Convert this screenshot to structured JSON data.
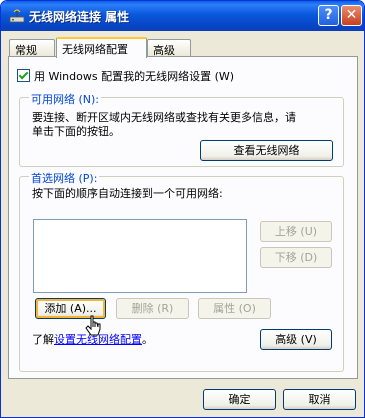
{
  "window": {
    "title": "无线网络连接 属性",
    "help_button": "?",
    "close_button": "✕"
  },
  "tabs": [
    {
      "label": "常规",
      "active": false
    },
    {
      "label": "无线网络配置",
      "active": true
    },
    {
      "label": "高级",
      "active": false
    }
  ],
  "use_windows_checkbox": {
    "label": "用 Windows 配置我的无线网络设置 (W)",
    "checked": true
  },
  "available_networks": {
    "group_label": "可用网络 (N):",
    "description_line1": "要连接、断开区域内无线网络或查找有关更多信息，请",
    "description_line2": "单击下面的按钮。",
    "view_button": "查看无线网络"
  },
  "preferred_networks": {
    "group_label": "首选网络 (P):",
    "description": "按下面的顺序自动连接到一个可用网络:",
    "move_up_button": "上移 (U)",
    "move_down_button": "下移 (D)",
    "add_button": "添加 (A)...",
    "remove_button": "删除 (R)",
    "properties_button": "属性 (O)"
  },
  "learn_more": {
    "prefix": "了解",
    "link": "设置无线网络配置",
    "suffix": "。"
  },
  "advanced_button": "高级 (V)",
  "footer": {
    "ok_button": "确定",
    "cancel_button": "取消"
  },
  "colors": {
    "titlebar": "#0a58db",
    "group_label": "#0046d5",
    "focus_highlight": "#f8b330",
    "link": "#0000ff"
  }
}
